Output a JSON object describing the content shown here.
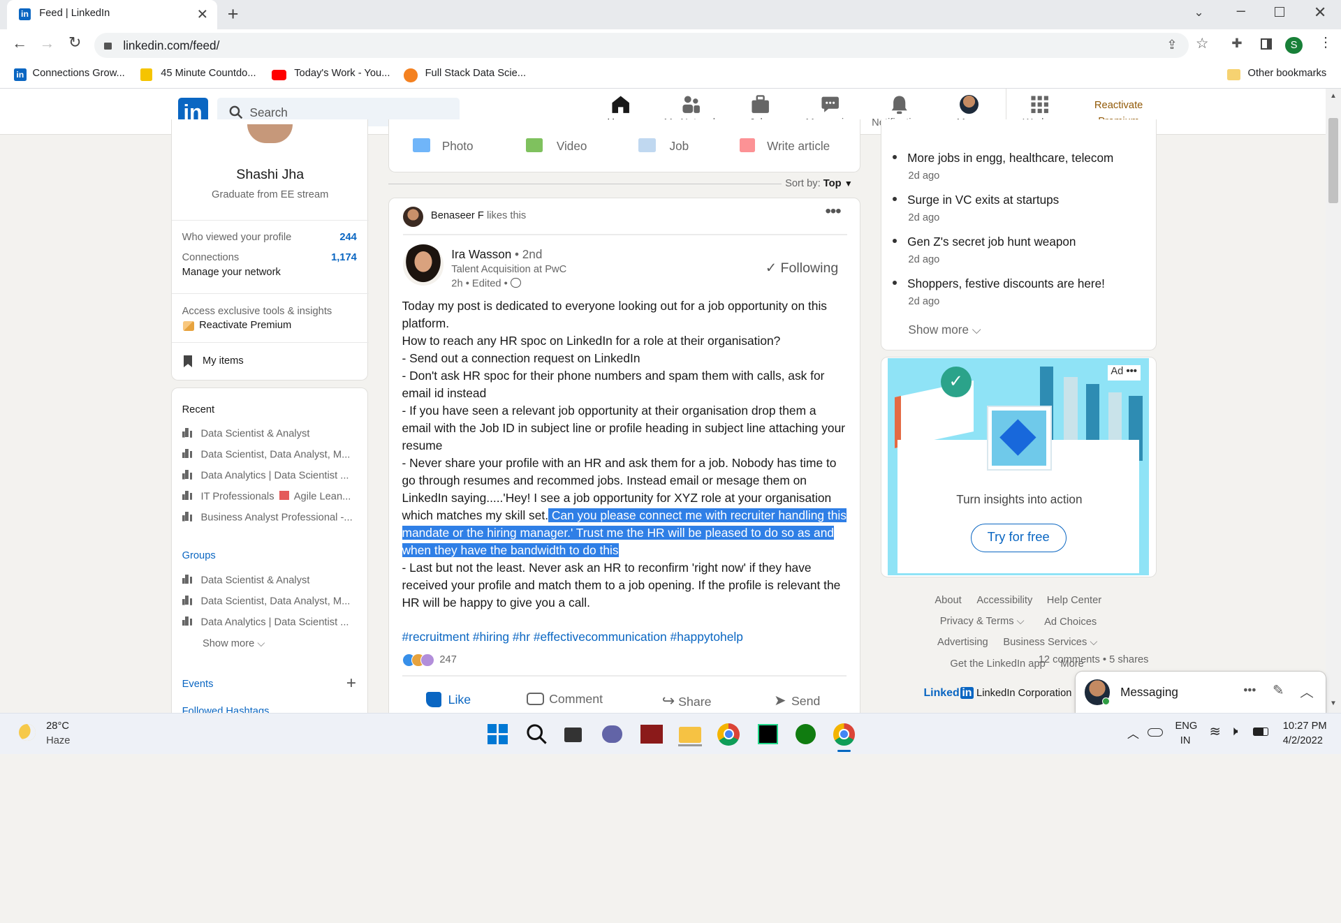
{
  "browser": {
    "tab_title": "Feed | LinkedIn",
    "url": "linkedin.com/feed/",
    "profile_initial": "S",
    "bookmarks": [
      "Connections Grow...",
      "45 Minute Countdo...",
      "Today's Work - You...",
      "Full Stack Data Scie..."
    ],
    "other_bookmarks": "Other bookmarks"
  },
  "nav": {
    "search_placeholder": "Search",
    "home": "Home",
    "network": "My Network",
    "jobs": "Jobs",
    "messaging": "Messaging",
    "notifications": "Notifications",
    "me": "Me",
    "work": "Work",
    "premium_line1": "Reactivate",
    "premium_line2": "Premium"
  },
  "profile": {
    "name": "Shashi Jha",
    "headline": "Graduate from EE stream",
    "viewed_label": "Who viewed your profile",
    "viewed_count": "244",
    "connections_label": "Connections",
    "connections_count": "1,174",
    "manage_network": "Manage your network",
    "tools_label": "Access exclusive tools & insights",
    "reactivate": "Reactivate Premium",
    "my_items": "My items"
  },
  "sidebar": {
    "recent_title": "Recent",
    "recent": [
      "Data Scientist & Analyst",
      "Data Scientist, Data Analyst, M...",
      "Data Analytics | Data Scientist ...",
      "IT Professionals",
      "Agile Lean...",
      "Business Analyst Professional -..."
    ],
    "groups_title": "Groups",
    "groups": [
      "Data Scientist & Analyst",
      "Data Scientist, Data Analyst, M...",
      "Data Analytics | Data Scientist ..."
    ],
    "show_more": "Show more",
    "events": "Events",
    "followed_hashtags": "Followed Hashtags"
  },
  "share": {
    "photo": "Photo",
    "video": "Video",
    "job": "Job",
    "article": "Write article",
    "sort_label": "Sort by:",
    "sort_value": "Top"
  },
  "post": {
    "liker_name": "Benaseer F",
    "liker_action": "likes this",
    "author": "Ira Wasson",
    "degree": "• 2nd",
    "headline": "Talent Acquisition at PwC",
    "meta": "2h • Edited •",
    "following": "Following",
    "para1": "Today my post is dedicated to everyone looking out for a job opportunity on this platform.",
    "para2": "How to reach any HR spoc on LinkedIn for a role at their organisation?",
    "para3": "- Send out a connection request on LinkedIn",
    "para4": "- Don't ask HR spoc for their phone numbers and spam them with calls, ask for email id instead",
    "para5": "- If you have seen a relevant job opportunity at their organisation drop them a email with the Job ID in subject line or profile heading in subject line attaching your resume",
    "para6a": "- Never share your profile with an HR and ask them for a job. Nobody has time to go through resumes and recommed jobs. Instead email or mesage them on LinkedIn saying.....'Hey! I see a job opportunity for XYZ role at your organisation which matches my skill set.",
    "para6b": " Can you please connect me with recruiter handling this mandate or the hiring manager.' Trust me the HR will be pleased to do so as and when they have the bandwidth to do this",
    "para7": "- Last but not the least. Never ask an HR to reconfirm 'right now' if they have received your profile and match them to a job opening. If the profile is relevant the HR will be happy to give you a call.",
    "hashtags": "#recruitment #hiring #hr #effectivecommunication #happytohelp",
    "reactions": "247",
    "comments_shares": "12 comments • 5 shares",
    "like": "Like",
    "comment": "Comment",
    "share": "Share",
    "send": "Send"
  },
  "news": {
    "items": [
      {
        "title": "More jobs in engg, healthcare, telecom",
        "ago": "2d ago"
      },
      {
        "title": "Surge in VC exits at startups",
        "ago": "2d ago"
      },
      {
        "title": "Gen Z's secret job hunt weapon",
        "ago": "2d ago"
      },
      {
        "title": "Shoppers, festive discounts are here!",
        "ago": "2d ago"
      }
    ],
    "show_more": "Show more"
  },
  "ad": {
    "label": "Ad",
    "tagline": "Turn insights into action",
    "cta": "Try for free"
  },
  "footer": {
    "about": "About",
    "accessibility": "Accessibility",
    "help": "Help Center",
    "privacy": "Privacy & Terms",
    "ad_choices": "Ad Choices",
    "advertising": "Advertising",
    "business": "Business Services",
    "app": "Get the LinkedIn app",
    "more": "More",
    "brand": "Linked",
    "brand_in": "in",
    "corp": "LinkedIn Corporation"
  },
  "messaging": {
    "label": "Messaging"
  },
  "taskbar": {
    "temp": "28°C",
    "weather": "Haze",
    "lang1": "ENG",
    "lang2": "IN",
    "time": "10:27 PM",
    "date": "4/2/2022"
  },
  "colors": {
    "linkedin_blue": "#0a66c2",
    "highlight": "#2f7fe6",
    "premium": "#915907"
  }
}
